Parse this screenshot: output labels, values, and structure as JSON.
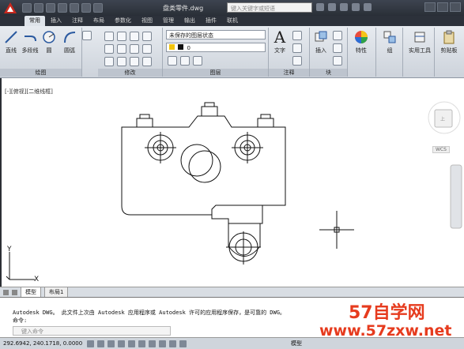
{
  "title_bar": {
    "document_title": "盘类零件.dwg",
    "search_placeholder": "键入关键字或短语"
  },
  "ribbon": {
    "tabs": [
      "常用",
      "插入",
      "注释",
      "布局",
      "参数化",
      "视图",
      "管理",
      "输出",
      "插件",
      "联机"
    ],
    "active_tab": "常用",
    "draw_panel": {
      "label": "绘图",
      "tools": [
        "直线",
        "多段线",
        "圆",
        "圆弧"
      ]
    },
    "modify_panel": {
      "label": "修改"
    },
    "layers_panel": {
      "label": "图层",
      "layer_state": "未保存的图层状态",
      "current_layer": "0"
    },
    "annotation_panel": {
      "label": "注释",
      "tool": "文字"
    },
    "block_panel": {
      "label": "块",
      "tool": "插入"
    },
    "properties_tool": "特性",
    "group_tool": "组",
    "utilities_tool": "实用工具",
    "clipboard_tool": "剪贴板"
  },
  "viewport": {
    "label": "[-][俯视][二维线框]",
    "viewcube_label": "WCS"
  },
  "layout_tabs": [
    "模型",
    "布局1"
  ],
  "active_layout_tab": "模型",
  "command": {
    "history": [
      "Autodesk DWG。   此文件上次由  Autodesk 应用程序或  Autodesk 许可的应用程序保存，是可靠的 DWG。",
      "命令:"
    ],
    "input_placeholder": "键入命令"
  },
  "status_bar": {
    "coordinates": "292.6942, 240.1718, 0.0000",
    "model_label": "模型"
  },
  "watermark": {
    "line1": "57自学网",
    "line2": "www.57zxw.net"
  },
  "colors": {
    "accent_red": "#e63b1e",
    "dark_chrome": "#2c313a",
    "ribbon_bg": "#dfe4ea"
  }
}
